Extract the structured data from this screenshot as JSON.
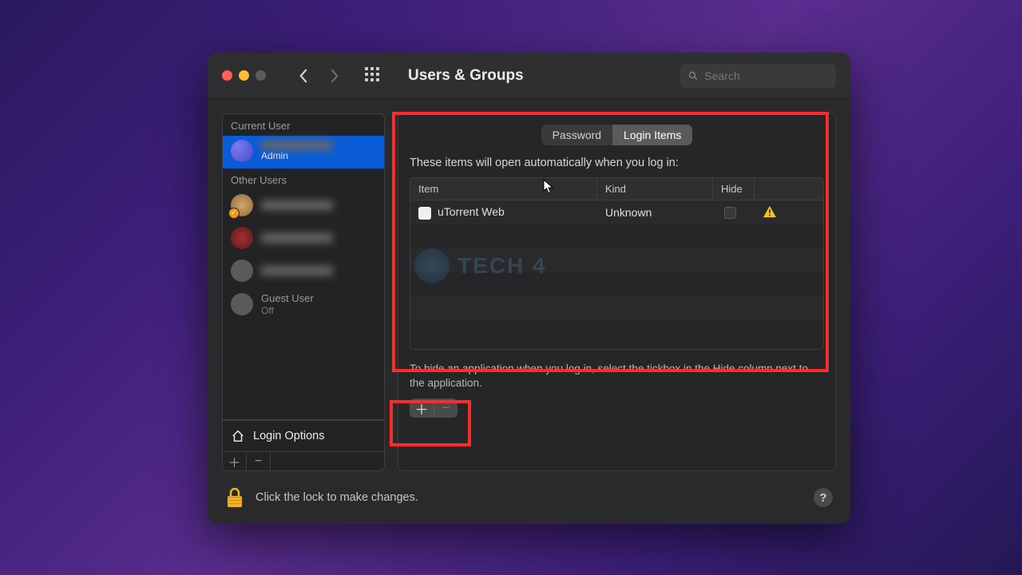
{
  "window": {
    "title": "Users & Groups",
    "search_placeholder": "Search"
  },
  "sidebar": {
    "current_label": "Current User",
    "other_label": "Other Users",
    "current_user": {
      "role": "Admin"
    },
    "other_users": [
      {
        "name": ""
      },
      {
        "name": ""
      },
      {
        "name": ""
      }
    ],
    "guest": {
      "name": "Guest User",
      "status": "Off"
    },
    "login_options": "Login Options"
  },
  "tabs": {
    "password": "Password",
    "login_items": "Login Items"
  },
  "content": {
    "description": "These items will open automatically when you log in:",
    "columns": {
      "item": "Item",
      "kind": "Kind",
      "hide": "Hide"
    },
    "rows": [
      {
        "item": "uTorrent Web",
        "kind": "Unknown",
        "hide": false,
        "warning": true
      }
    ],
    "hint": "To hide an application when you log in, select the tickbox in the Hide column next to the application.",
    "watermark": "TECH 4"
  },
  "footer": {
    "lock_text": "Click the lock to make changes."
  }
}
